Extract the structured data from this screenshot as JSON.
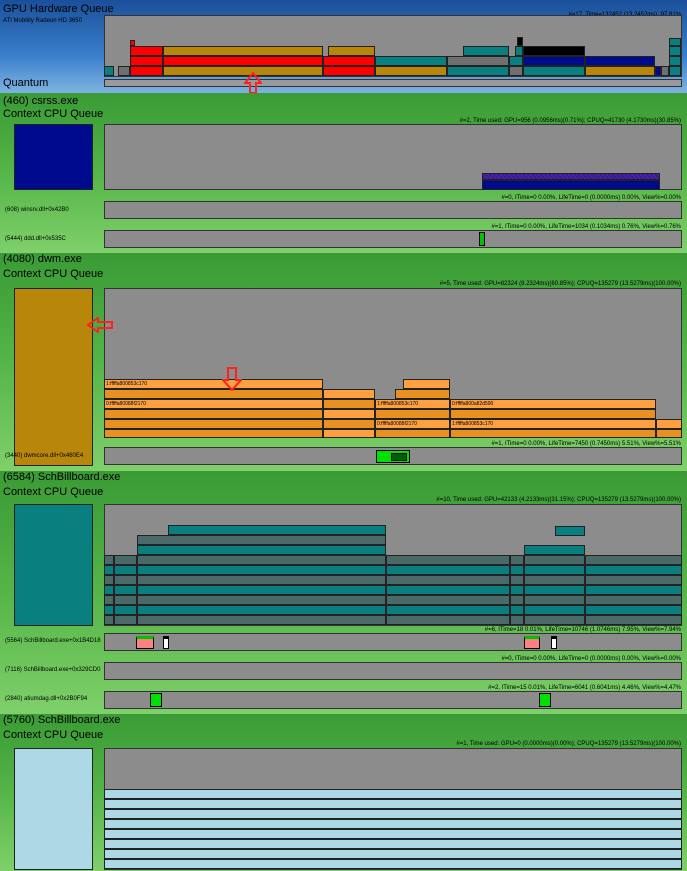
{
  "gpu": {
    "title": "GPU Hardware Queue",
    "subtitle": "ATI Mobility Radeon HD 3650",
    "stats": "#=17, Time=132452 (13.2452ms), 97.81%",
    "quantum_label": "Quantum"
  },
  "procs": [
    {
      "name": "(460) csrss.exe",
      "queue_label": "Context CPU Queue",
      "stats": "#=2, Time used: GPU=956 (0.0956ms)(0.71%); CPUQ=41730 (4.1730ms)(30.85%)",
      "color": "#000a8c",
      "threads": [
        {
          "label": "(608) winsrv.dll+0x42B0",
          "stats": "#=0, ITime=0 0.00%, LifeTime=0 (0.0000ms) 0.00%, View%=0.00%"
        },
        {
          "label": "(5444) ddd.dll+0x535C",
          "stats": "#=1, ITime=0 0.00%, LifeTime=1034 (0.1034ms) 0.76%, View%=0.76%"
        }
      ]
    },
    {
      "name": "(4080) dwm.exe",
      "queue_label": "Context CPU Queue",
      "stats": "#=5, Time used: GPU=82324 (8.2324ms)(60.85%); CPUQ=135279 (13.5279ms)(100.00%)",
      "color": "#b8860b",
      "block_labels": [
        "1:fffffa800853c170",
        "0:fffffa80088f2170",
        "1:fffffa800853c170",
        "0:fffffa800a82d590",
        "0:fffffa80088f2170",
        "1:fffffa800853c170"
      ],
      "threads": [
        {
          "label": "(3440) dwmcore.dll+0x460E4",
          "stats": "#=1, ITime=0 0.00%, LifeTime=7450 (0.7450ms) 5.51%, View%=5.51%"
        }
      ]
    },
    {
      "name": "(6584) SchBillboard.exe",
      "queue_label": "Context CPU Queue",
      "stats": "#=10, Time used: GPU=42133 (4.2133ms)(31.15%); CPUQ=135279 (13.5279ms)(100.00%)",
      "color": "#0a7f7f",
      "threads": [
        {
          "label": "(5564) SchBillboard.exe+0x1B4D18",
          "stats": "#=6, ITime=18 0.01%, LifeTime=10746 (1.0746ms) 7.95%, View%=7.94%"
        },
        {
          "label": "(7116) SchBillboard.exe+0x329CD0",
          "stats": "#=0, ITime=0 0.00%, LifeTime=0 (0.0000ms) 0.00%, View%=0.00%"
        },
        {
          "label": "(2840) atiumdag.dll+0x2B0F94",
          "stats": "#=2, ITime=15 0.01%, LifeTime=6041 (0.6041ms) 4.46%, View%=4.47%"
        }
      ]
    },
    {
      "name": "(5760) SchBillboard.exe",
      "queue_label": "Context CPU Queue",
      "stats": "#=1, Time used: GPU=0 (0.0000ms)(0.00%); CPUQ=135279 (13.5279ms)(100.00%)",
      "color": "#add8e6"
    }
  ]
}
